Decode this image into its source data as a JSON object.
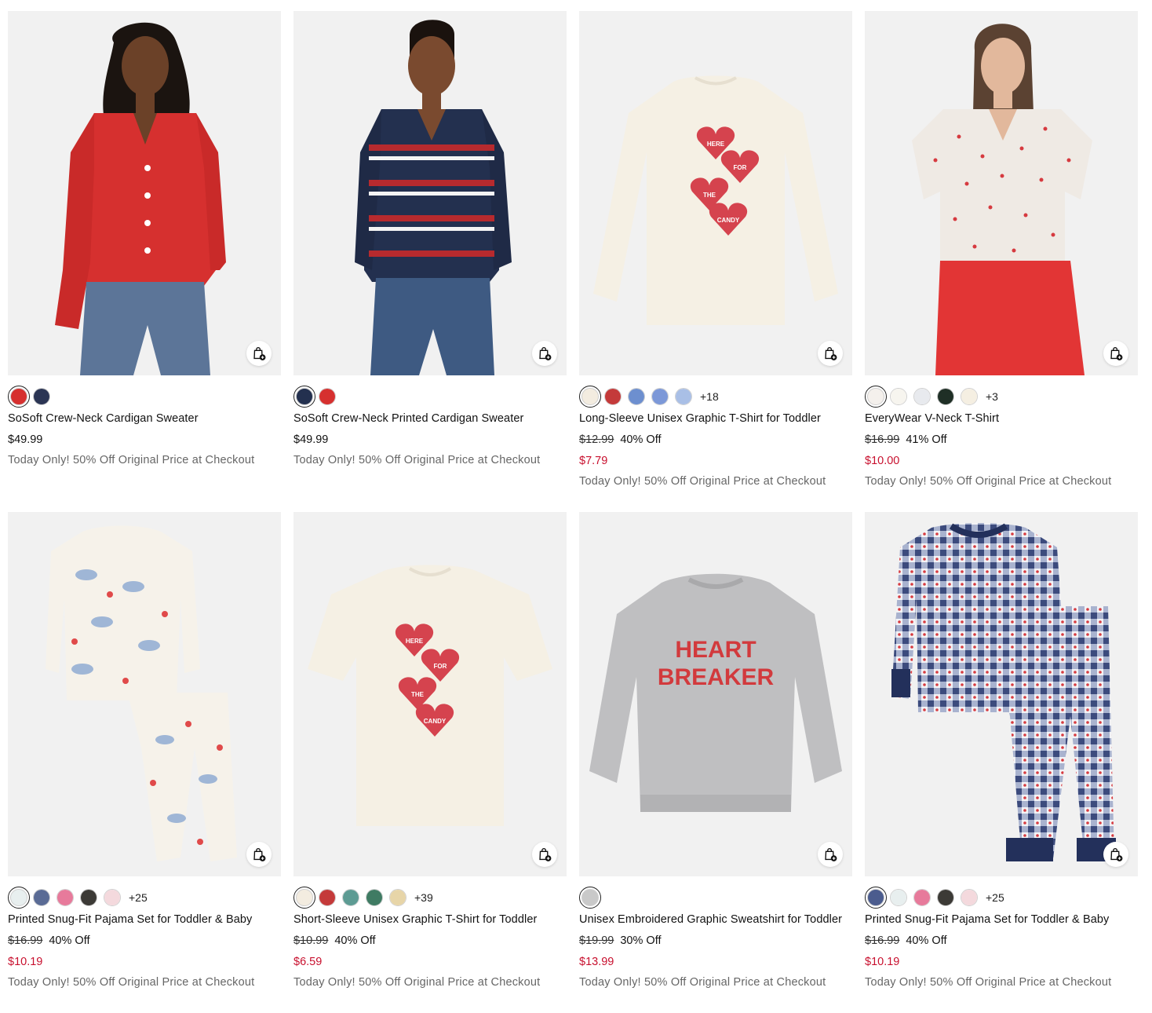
{
  "products": [
    {
      "name": "SoSoft Crew-Neck Cardigan Sweater",
      "price": "$49.99",
      "promo": "Today Only! 50% Off Original Price at Checkout",
      "swatches": [
        "#d6302f",
        "#2b3554"
      ],
      "more": ""
    },
    {
      "name": "SoSoft Crew-Neck Printed Cardigan Sweater",
      "price": "$49.99",
      "promo": "Today Only! 50% Off Original Price at Checkout",
      "swatches": [
        "#23304f",
        "#d6302f"
      ],
      "more": ""
    },
    {
      "name": "Long-Sleeve Unisex Graphic T-Shirt for Toddler",
      "original_price": "$12.99",
      "discount": "40% Off",
      "sale_price": "$7.79",
      "promo": "Today Only! 50% Off Original Price at Checkout",
      "swatches": [
        "#f3ece0",
        "#c43a3a",
        "#6d8fcf",
        "#7c98d8",
        "#a9bfe6"
      ],
      "more": "+18"
    },
    {
      "name": "EveryWear V-Neck T-Shirt",
      "original_price": "$16.99",
      "discount": "41% Off",
      "sale_price": "$10.00",
      "promo": "Today Only! 50% Off Original Price at Checkout",
      "swatches": [
        "#f4f0ec",
        "#f7f5ef",
        "#e8eaee",
        "#1f2f26",
        "#f5efe2"
      ],
      "more": "+3"
    },
    {
      "name": "Printed Snug-Fit Pajama Set for Toddler & Baby",
      "original_price": "$16.99",
      "discount": "40% Off",
      "sale_price": "$10.19",
      "promo": "Today Only! 50% Off Original Price at Checkout",
      "swatches": [
        "#e8efef",
        "#5a6b95",
        "#e77a9b",
        "#3c3a36",
        "#f4d9dd"
      ],
      "more": "+25"
    },
    {
      "name": "Short-Sleeve Unisex Graphic T-Shirt for Toddler",
      "original_price": "$10.99",
      "discount": "40% Off",
      "sale_price": "$6.59",
      "promo": "Today Only! 50% Off Original Price at Checkout",
      "swatches": [
        "#f3ece0",
        "#c43a3a",
        "#5d9b93",
        "#3f7b63",
        "#e7d5a8"
      ],
      "more": "+39"
    },
    {
      "name": "Unisex Embroidered Graphic Sweatshirt for Toddler",
      "original_price": "$19.99",
      "discount": "30% Off",
      "sale_price": "$13.99",
      "promo": "Today Only! 50% Off Original Price at Checkout",
      "swatches": [
        "#c9c9c9"
      ],
      "more": ""
    },
    {
      "name": "Printed Snug-Fit Pajama Set for Toddler & Baby",
      "original_price": "$16.99",
      "discount": "40% Off",
      "sale_price": "$10.19",
      "promo": "Today Only! 50% Off Original Price at Checkout",
      "swatches": [
        "#4b5c8e",
        "#e8efef",
        "#e77a9b",
        "#3c3a36",
        "#f4d9dd"
      ],
      "more": "+25"
    }
  ],
  "colors": {
    "sale": "#c8102e",
    "promo": "#666666",
    "card_bg": "#f2f2f2"
  },
  "icons": {
    "add_to_bag": "shopping-bag-plus-icon"
  },
  "hero_text": {
    "tee_heart_1": "HERE",
    "tee_heart_2": "FOR",
    "tee_heart_3": "THE",
    "tee_heart_4": "CANDY",
    "sweat_line_1": "HEART",
    "sweat_line_2": "BREAKER"
  }
}
